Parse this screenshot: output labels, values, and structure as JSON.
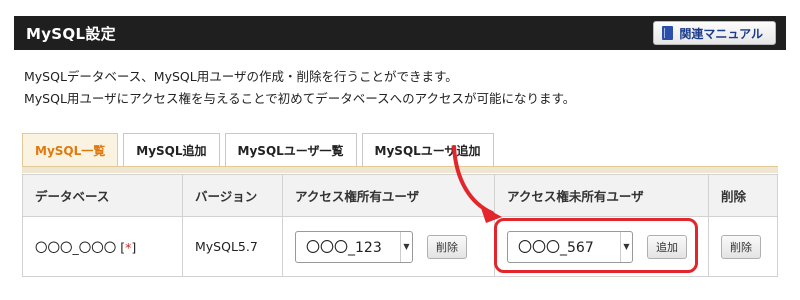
{
  "header": {
    "title": "MySQL設定",
    "manual_button": "関連マニュアル"
  },
  "description": {
    "line1": "MySQLデータベース、MySQL用ユーザの作成・削除を行うことができます。",
    "line2": "MySQL用ユーザにアクセス権を与えることで初めてデータベースへのアクセスが可能になります。"
  },
  "tabs": [
    {
      "label": "MySQL一覧",
      "active": true
    },
    {
      "label": "MySQL追加",
      "active": false
    },
    {
      "label": "MySQLユーザ一覧",
      "active": false
    },
    {
      "label": "MySQLユーザ追加",
      "active": false
    }
  ],
  "table": {
    "headers": [
      "データベース",
      "バージョン",
      "アクセス権所有ユーザ",
      "アクセス権未所有ユーザ",
      "削除"
    ],
    "row": {
      "database": "〇〇〇_〇〇〇",
      "required_mark": "*",
      "version": "MySQL5.7",
      "owner_user": "〇〇〇_123",
      "owner_action": "削除",
      "nonowner_user": "〇〇〇_567",
      "nonowner_action": "追加",
      "delete_action": "削除"
    }
  },
  "colors": {
    "header_bg": "#1f1f1f",
    "active_tab": "#e07a10",
    "highlight": "#e2262b"
  },
  "icons": [
    "book-icon",
    "chevron-down-icon",
    "red-arrow-annotation"
  ]
}
